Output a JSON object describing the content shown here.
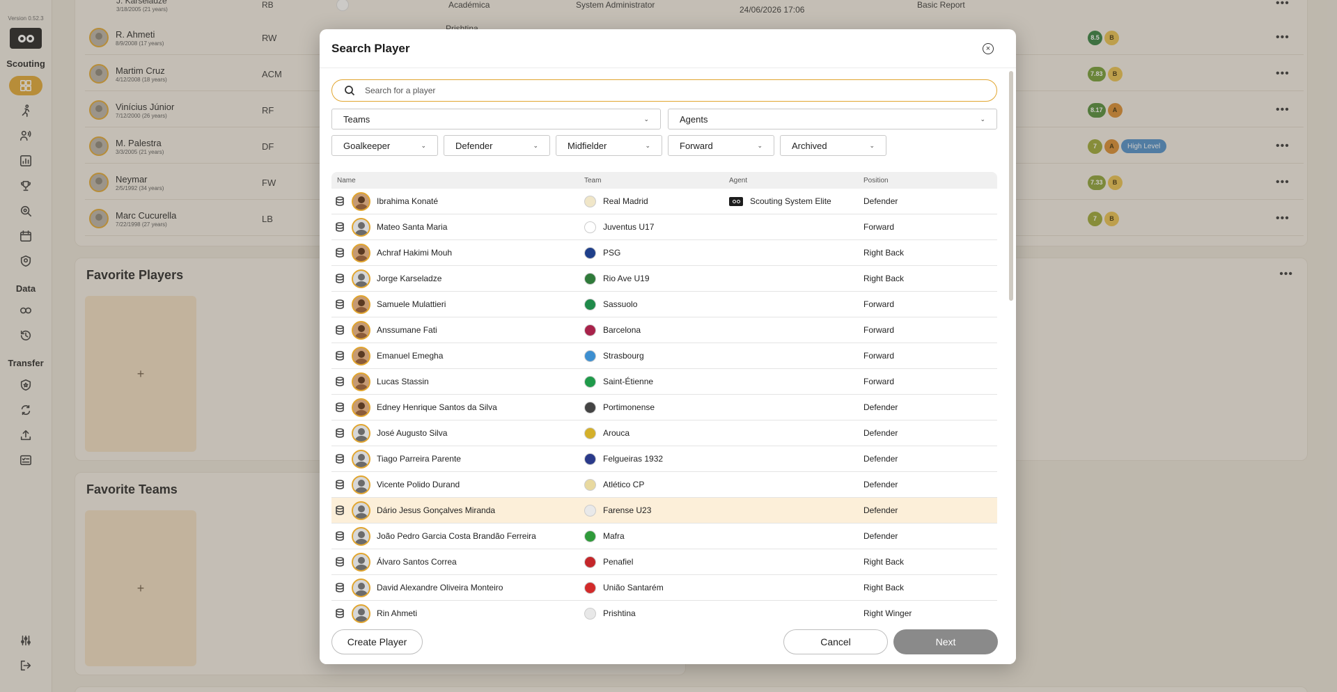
{
  "sidebar": {
    "version": "Version 0.52.3",
    "sections": {
      "scouting": "Scouting",
      "data": "Data",
      "transfer": "Transfer"
    }
  },
  "background": {
    "top_row": {
      "name": "J. Karseladze",
      "dob": "3/18/2005 (21 years)",
      "position": "RB",
      "team": "Académica",
      "author": "System Administrator",
      "date": "24/06/2026 17:06",
      "report": "Basic Report"
    },
    "team_below": "Prishtina",
    "players": [
      {
        "name": "R. Ahmeti",
        "dob": "8/9/2008 (17 years)",
        "position": "RW",
        "score": "8.5",
        "score_color": "#2f7d3a",
        "grade": "B",
        "tag": ""
      },
      {
        "name": "Martim Cruz",
        "dob": "4/12/2008 (18 years)",
        "position": "ACM",
        "score": "7.83",
        "score_color": "#6f9a2f",
        "grade": "B",
        "tag": ""
      },
      {
        "name": "Vinícius Júnior",
        "dob": "7/12/2000 (26 years)",
        "position": "RF",
        "score": "8.17",
        "score_color": "#4d8a33",
        "grade": "A",
        "tag": ""
      },
      {
        "name": "M. Palestra",
        "dob": "3/3/2005 (21 years)",
        "position": "DF",
        "score": "7",
        "score_color": "#9aa630",
        "grade": "A",
        "tag": "High Level"
      },
      {
        "name": "Neymar",
        "dob": "2/5/1992 (34 years)",
        "position": "FW",
        "score": "7.33",
        "score_color": "#8aa032",
        "grade": "B",
        "tag": ""
      },
      {
        "name": "Marc Cucurella",
        "dob": "7/22/1998 (27 years)",
        "position": "LB",
        "score": "7",
        "score_color": "#9aa630",
        "grade": "B",
        "tag": ""
      }
    ],
    "favorite_players_title": "Favorite Players",
    "favorite_teams_title": "Favorite Teams",
    "add_symbol": "+"
  },
  "modal": {
    "title": "Search Player",
    "close_symbol": "×",
    "search_placeholder": "Search for a player",
    "filters": {
      "teams": "Teams",
      "agents": "Agents",
      "goalkeeper": "Goalkeeper",
      "defender": "Defender",
      "midfielder": "Midfielder",
      "forward": "Forward",
      "archived": "Archived"
    },
    "columns": {
      "name": "Name",
      "team": "Team",
      "agent": "Agent",
      "position": "Position"
    },
    "rows": [
      {
        "name": "Ibrahima Konaté",
        "team": "Real Madrid",
        "crest": "#f0e6c8",
        "agent": "Scouting System Elite",
        "position": "Defender",
        "photo": true
      },
      {
        "name": "Mateo Santa Maria",
        "team": "Juventus U17",
        "crest": "#ffffff",
        "agent": "",
        "position": "Forward",
        "photo": false
      },
      {
        "name": "Achraf Hakimi Mouh",
        "team": "PSG",
        "crest": "#1f3f8a",
        "agent": "",
        "position": "Right Back",
        "photo": true
      },
      {
        "name": "Jorge Karseladze",
        "team": "Rio Ave U19",
        "crest": "#2f7a3a",
        "agent": "",
        "position": "Right Back",
        "photo": false
      },
      {
        "name": "Samuele Mulattieri",
        "team": "Sassuolo",
        "crest": "#1f8a4a",
        "agent": "",
        "position": "Forward",
        "photo": true
      },
      {
        "name": "Anssumane Fati",
        "team": "Barcelona",
        "crest": "#a8224a",
        "agent": "",
        "position": "Forward",
        "photo": true
      },
      {
        "name": "Emanuel Emegha",
        "team": "Strasbourg",
        "crest": "#3d8fd0",
        "agent": "",
        "position": "Forward",
        "photo": true
      },
      {
        "name": "Lucas Stassin",
        "team": "Saint-Étienne",
        "crest": "#1f9a4a",
        "agent": "",
        "position": "Forward",
        "photo": true
      },
      {
        "name": "Edney Henrique Santos da Silva",
        "team": "Portimonense",
        "crest": "#444444",
        "agent": "",
        "position": "Defender",
        "photo": true
      },
      {
        "name": "José Augusto Silva",
        "team": "Arouca",
        "crest": "#d4b02a",
        "agent": "",
        "position": "Defender",
        "photo": false
      },
      {
        "name": "Tiago Parreira Parente",
        "team": "Felgueiras 1932",
        "crest": "#2a3a8a",
        "agent": "",
        "position": "Defender",
        "photo": false
      },
      {
        "name": "Vicente Polido Durand",
        "team": "Atlético CP",
        "crest": "#e8d9a0",
        "agent": "",
        "position": "Defender",
        "photo": false
      },
      {
        "name": "Dário Jesus Gonçalves Miranda",
        "team": "Farense U23",
        "crest": "#e9e9e9",
        "agent": "",
        "position": "Defender",
        "photo": false
      },
      {
        "name": "João Pedro Garcia Costa Brandão Ferreira",
        "team": "Mafra",
        "crest": "#2f9a3a",
        "agent": "",
        "position": "Defender",
        "photo": false
      },
      {
        "name": "Álvaro Santos Correa",
        "team": "Penafiel",
        "crest": "#c4262a",
        "agent": "",
        "position": "Right Back",
        "photo": false
      },
      {
        "name": "David Alexandre Oliveira Monteiro",
        "team": "União Santarém",
        "crest": "#d22a2a",
        "agent": "",
        "position": "Right Back",
        "photo": false
      },
      {
        "name": "Rin Ahmeti",
        "team": "Prishtina",
        "crest": "#e8e8e8",
        "agent": "",
        "position": "Right Winger",
        "photo": false
      }
    ],
    "highlight_row": 12,
    "buttons": {
      "create": "Create Player",
      "cancel": "Cancel",
      "next": "Next"
    }
  },
  "colors": {
    "accent": "#e1a52e",
    "highlight_row": "#fcefd9",
    "next_button": "#8a8a8a"
  }
}
